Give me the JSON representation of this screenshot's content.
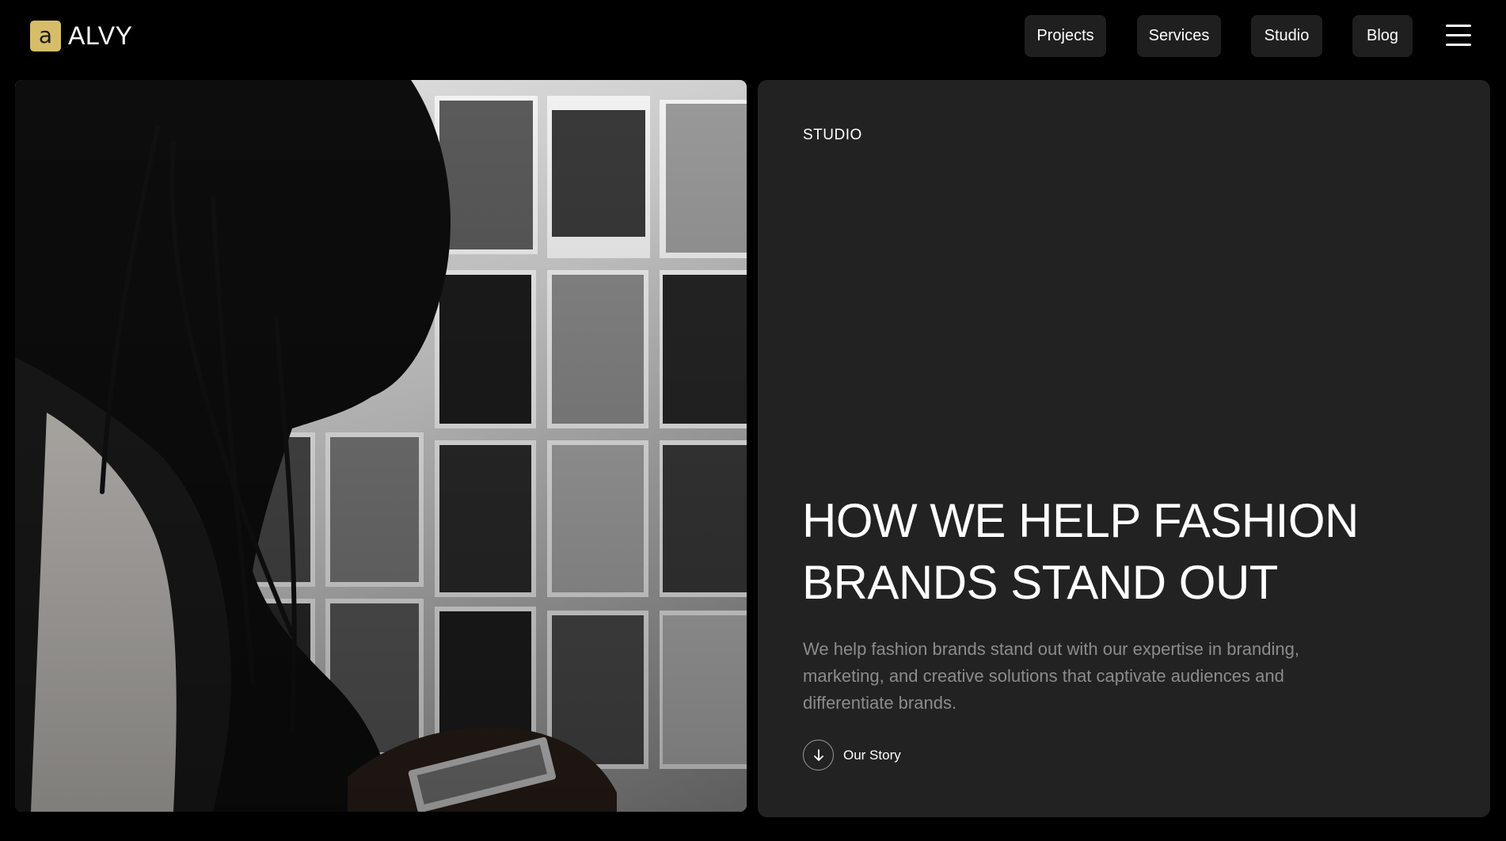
{
  "brand": {
    "mark": "a",
    "name": "ALVY",
    "mark_color": "#d6bd6a"
  },
  "nav": {
    "items": [
      {
        "label": "Projects"
      },
      {
        "label": "Services"
      },
      {
        "label": "Studio"
      },
      {
        "label": "Blog"
      }
    ],
    "menu_icon": "hamburger-menu-icon"
  },
  "hero": {
    "image": "photo of a woman in silhouette viewing a wall of black-and-white fashion prints",
    "eyebrow": "STUDIO",
    "headline_lines": [
      "HOW WE HELP FASHION",
      "BRANDS STAND OUT"
    ],
    "description": "We help fashion brands stand out with our expertise in branding, marketing, and creative solutions that captivate audiences and differentiate brands.",
    "cta_label": "Our Story",
    "cta_icon": "arrow-down-icon"
  },
  "colors": {
    "page_background": "#000000",
    "card_background": "#222222",
    "nav_pill": "#1f1f1f",
    "body_text_muted": "#8c8c8c"
  }
}
